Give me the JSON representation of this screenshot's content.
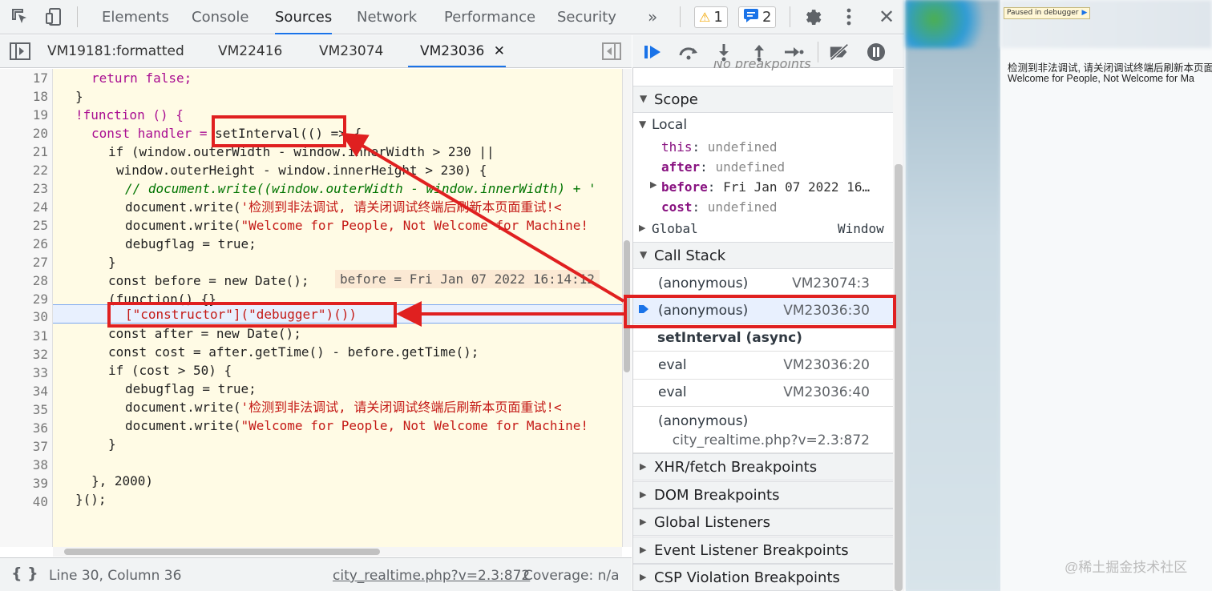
{
  "devtools": {
    "tabs": [
      "Elements",
      "Console",
      "Sources",
      "Network",
      "Performance",
      "Security"
    ],
    "active_tab": "Sources",
    "more_tabs": "»",
    "warnings_count": "1",
    "messages_count": "2",
    "close": "✕"
  },
  "file_tabs": [
    {
      "label": "VM19181:formatted"
    },
    {
      "label": "VM22416"
    },
    {
      "label": "VM23074"
    },
    {
      "label": "VM23036",
      "active": true
    }
  ],
  "code_lines": [
    {
      "n": "17"
    },
    {
      "n": "18"
    },
    {
      "n": "19"
    },
    {
      "n": "20"
    },
    {
      "n": "21"
    },
    {
      "n": "22"
    },
    {
      "n": "23"
    },
    {
      "n": "24"
    },
    {
      "n": "25"
    },
    {
      "n": "26"
    },
    {
      "n": "27"
    },
    {
      "n": "28"
    },
    {
      "n": "29"
    },
    {
      "n": "30"
    },
    {
      "n": "31"
    },
    {
      "n": "32"
    },
    {
      "n": "33"
    },
    {
      "n": "34"
    },
    {
      "n": "35"
    },
    {
      "n": "36"
    },
    {
      "n": "37"
    },
    {
      "n": "38"
    },
    {
      "n": "39"
    },
    {
      "n": "40"
    }
  ],
  "code_text": {
    "l17": "return false;",
    "l18": "}",
    "l19": "!function () {",
    "l20a": "const handler = ",
    "l20b": "setInterval(()",
    "l20c": " => {",
    "l21": "if (window.outerWidth - window.innerWidth > 230 ||",
    "l22": "window.outerHeight - window.innerHeight > 230) {",
    "l23": "// document.write((window.outerWidth - window.innerWidth) + '",
    "l24a": "document.write(",
    "l24b": "'检测到非法调试, 请关闭调试终端后刷新本页面重试!<",
    "l25a": "document.write(",
    "l25b": "\"Welcome for People, Not Welcome for Machine!",
    "l26": "debugflag = true;",
    "l27": "}",
    "l28": "const before = new Date();",
    "l28_inline": "before = Fri Jan 07 2022 16:14:12",
    "l29": "(function() {}",
    "l30": "[\"constructor\"](\"debugger\")())",
    "l31": "const after = new Date();",
    "l32": "const cost = after.getTime() - before.getTime();",
    "l33": "if (cost > 50) {",
    "l34": "debugflag = true;",
    "l35a": "document.write(",
    "l35b": "'检测到非法调试, 请关闭调试终端后刷新本页面重试!<",
    "l36a": "document.write(",
    "l36b": "\"Welcome for People, Not Welcome for Machine!",
    "l37": "}",
    "l38": "",
    "l39": "}, 2000)",
    "l40": "}();"
  },
  "status": {
    "braces": "{ }",
    "position": "Line 30, Column 36",
    "source_link": "city_realtime.php?v=2.3:872",
    "coverage": "Coverage: n/a"
  },
  "debugger": {
    "no_breakpoints": "No breakpoints",
    "scope_title": "Scope",
    "local_title": "Local",
    "local_vars": [
      {
        "name": "this",
        "value": "undefined",
        "bold": false
      },
      {
        "name": "after",
        "value": "undefined",
        "bold": true
      },
      {
        "name": "before",
        "value": "Fri Jan 07 2022 16…",
        "bold": true
      },
      {
        "name": "cost",
        "value": "undefined",
        "bold": true
      }
    ],
    "global_title": "Global",
    "global_value": "Window",
    "callstack_title": "Call Stack",
    "callstack": [
      {
        "fn": "(anonymous)",
        "loc": "VM23074:3"
      },
      {
        "fn": "(anonymous)",
        "loc": "VM23036:30"
      },
      {
        "fn": "setInterval (async)",
        "loc": ""
      },
      {
        "fn": "eval",
        "loc": "VM23036:20"
      },
      {
        "fn": "eval",
        "loc": "VM23036:40"
      },
      {
        "fn": "(anonymous)",
        "loc": "city_realtime.php?v=2.3:872"
      }
    ],
    "sections": [
      "XHR/fetch Breakpoints",
      "DOM Breakpoints",
      "Global Listeners",
      "Event Listener Breakpoints",
      "CSP Violation Breakpoints"
    ]
  },
  "webpage": {
    "paused_label": "Paused in debugger",
    "line1": "检测到非法调试, 请关闭调试终端后刷新本页面",
    "line2": "Welcome for People, Not Welcome for Ma"
  },
  "watermark": "@稀土掘金技术社区",
  "colors": {
    "accent": "#1a73e8",
    "annotation_red": "#e02020",
    "editor_bg": "#fffbe5"
  }
}
